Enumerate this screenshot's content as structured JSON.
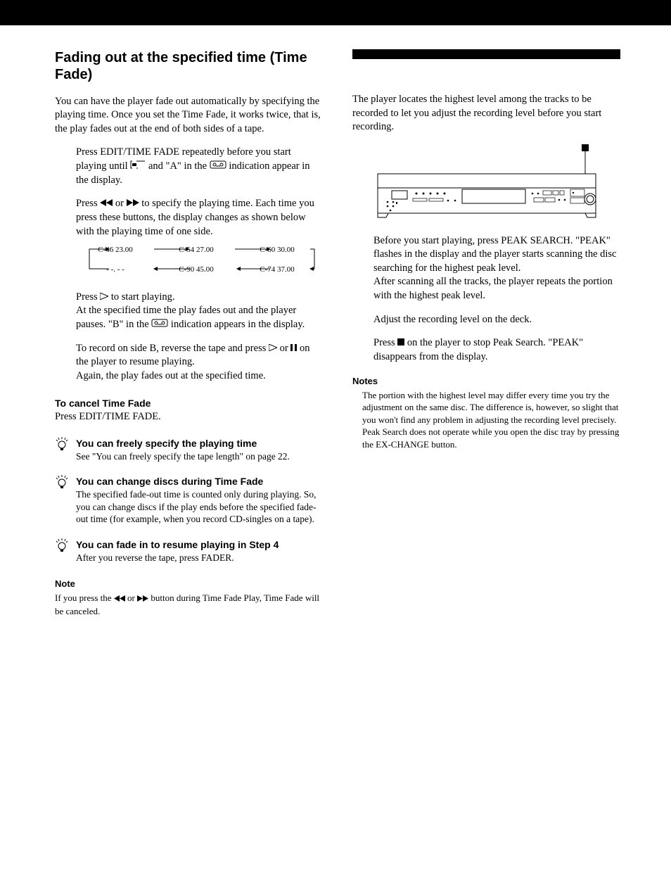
{
  "left": {
    "heading": "Fading out at the specified time (Time Fade)",
    "intro": "You can have the player fade out automatically by specifying the playing time. Once you set the Time Fade, it works twice, that is, the play fades out at the end of both sides of a tape.",
    "step1a": "Press EDIT/TIME FADE repeatedly before you start playing until ",
    "step1b": " and \"A\" in the ",
    "step1c": " indication appear in the display.",
    "step2a": "Press ",
    "step2b": " or ",
    "step2c": " to specify the playing time. Each time you press these buttons, the display changes as shown below with the playing time of one side.",
    "flow": {
      "c46": "C-46  23.00",
      "c54": "C-54  27.00",
      "c60": "C-60  30.00",
      "dash": "- -. - -",
      "c90": "C-90  45.00",
      "c74": "C-74  37.00"
    },
    "step3a": "Press ",
    "step3b": " to start playing.",
    "step3c": "At the specified time the play fades out and the player pauses. \"B\" in the ",
    "step3d": " indication appears in the display.",
    "step4a": "To record on side B, reverse the tape and press ",
    "step4b": " or ",
    "step4c": " on the player to resume playing.",
    "step4d": "Again, the play fades out at the specified time.",
    "cancel_h": "To cancel Time Fade",
    "cancel_b": "Press EDIT/TIME FADE.",
    "tip1_h": "You can freely specify the playing time",
    "tip1_b": "See \"You can freely specify the tape length\" on page 22.",
    "tip2_h": "You can change discs during Time Fade",
    "tip2_b": "The specified fade-out time is counted only during playing. So, you can change discs if the play ends before the specified fade-out time (for example, when you record CD-singles on a tape).",
    "tip3_h": "You can fade in to resume playing in Step 4",
    "tip3_b": "After you reverse the tape, press FADER.",
    "note_h": "Note",
    "note_a": "If you press the ",
    "note_b": " or ",
    "note_c": " button during Time Fade Play, Time Fade will be canceled."
  },
  "right": {
    "intro": "The player locates the highest level among the tracks to be recorded to let you adjust the recording level before you start recording.",
    "step1": "Before you start playing, press PEAK SEARCH. \"PEAK\" flashes in the display and the player starts scanning the disc searching for the highest peak level.",
    "step1b": "After scanning all the tracks, the player repeats the portion with the highest peak level.",
    "step2": "Adjust the recording level on the deck.",
    "step3a": "Press ",
    "step3b": " on the player to stop Peak Search. \"PEAK\" disappears from the display.",
    "notes_h": "Notes",
    "notes_b1": "The portion with the highest level may differ every time you try the adjustment on the same disc. The difference is, however, so slight that you won't find any problem in adjusting the recording level precisely.",
    "notes_b2": "Peak Search does not operate while you open the disc tray by pressing the EX-CHANGE button."
  }
}
